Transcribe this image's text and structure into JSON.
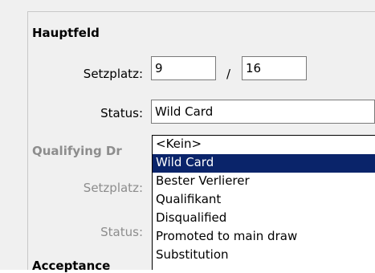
{
  "hauptfeld": {
    "title": "Hauptfeld",
    "setzplatz_label": "Setzplatz:",
    "setzplatz_value": "9",
    "slash": "/",
    "setzplatz_total": "16",
    "status_label": "Status:",
    "status_value": "Wild Card"
  },
  "qualifying": {
    "title": "Qualifying Dr",
    "setzplatz_label": "Setzplatz:",
    "status_label": "Status:"
  },
  "acceptance": {
    "title": "Acceptance"
  },
  "dropdown": {
    "options": [
      "<Kein>",
      "Wild Card",
      "Bester Verlierer",
      "Qualifikant",
      "Disqualified",
      "Promoted to main draw",
      "Substitution"
    ],
    "selected": "Wild Card"
  },
  "colors": {
    "selected_bg": "#0a246a",
    "selected_text": "#ffffff",
    "disabled_text": "#8d8d8d",
    "panel_bg": "#f0f0f0"
  }
}
